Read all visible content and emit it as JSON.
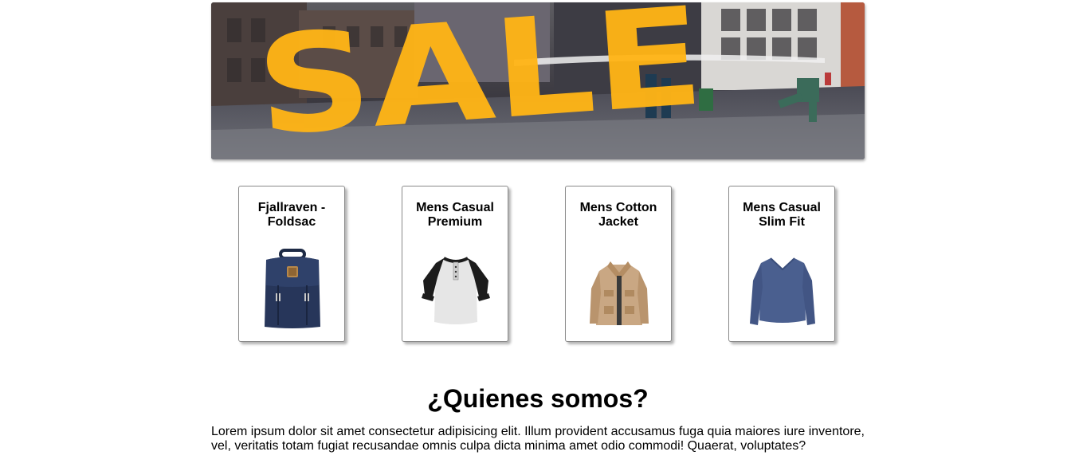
{
  "banner": {
    "text": "SALE"
  },
  "products": [
    {
      "title": "Fjallraven - Foldsac",
      "icon": "backpack-icon"
    },
    {
      "title": "Mens Casual Premium",
      "icon": "raglan-tshirt-icon"
    },
    {
      "title": "Mens Cotton Jacket",
      "icon": "jacket-icon"
    },
    {
      "title": "Mens Casual Slim Fit",
      "icon": "longsleeve-shirt-icon"
    }
  ],
  "about": {
    "title": "¿Quienes somos?",
    "text": "Lorem ipsum dolor sit amet consectetur adipisicing elit. Illum provident accusamus fuga quia maiores iure inventore, vel, veritatis totam fugiat recusandae omnis culpa dicta minima amet odio commodi! Quaerat, voluptates?"
  },
  "colors": {
    "sale_yellow": "#ffb516",
    "card_border": "#8a8a8a"
  }
}
